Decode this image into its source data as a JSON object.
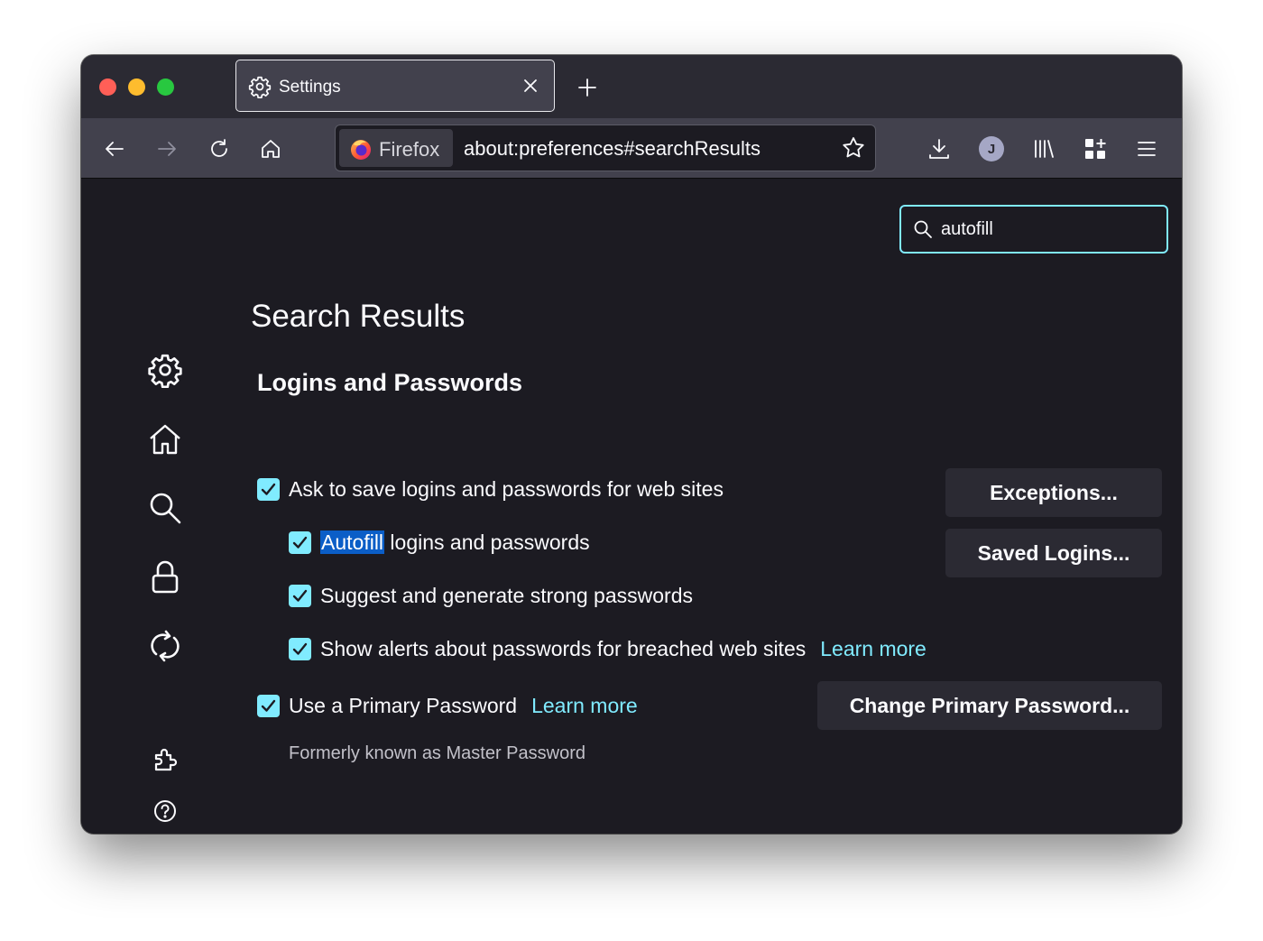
{
  "tab": {
    "title": "Settings"
  },
  "urlbar": {
    "identity": "Firefox",
    "url": "about:preferences#searchResults"
  },
  "profile": {
    "initial": "J"
  },
  "search": {
    "value": "autofill"
  },
  "page": {
    "title": "Search Results"
  },
  "section": {
    "title": "Logins and Passwords",
    "ask_to_save": {
      "label": "Ask to save logins and passwords for web sites",
      "checked": true
    },
    "autofill": {
      "highlight": "Autofill",
      "rest": " logins and passwords",
      "checked": true
    },
    "suggest": {
      "label": "Suggest and generate strong passwords",
      "checked": true
    },
    "alerts": {
      "label": "Show alerts about passwords for breached web sites",
      "link": "Learn more",
      "checked": true
    },
    "primary": {
      "label": "Use a Primary Password",
      "link": "Learn more",
      "checked": true
    },
    "primary_note": "Formerly known as Master Password",
    "buttons": {
      "exceptions": "Exceptions...",
      "saved_logins": "Saved Logins...",
      "change_primary": "Change Primary Password..."
    }
  },
  "colors": {
    "accent": "#80ebff",
    "background": "#1c1b22",
    "toolbar": "#42414d",
    "highlight": "#0b5ec7"
  },
  "icons": {
    "sidebar": [
      "gear-icon",
      "home-icon",
      "search-icon",
      "lock-icon",
      "sync-icon",
      "extensions-icon",
      "help-icon"
    ],
    "toolbar": [
      "back-arrow-icon",
      "forward-arrow-icon",
      "reload-icon",
      "home-icon",
      "firefox-logo-icon",
      "bookmark-star-icon",
      "download-icon",
      "account-avatar-icon",
      "library-icon",
      "extensions-icon",
      "hamburger-menu-icon"
    ]
  }
}
